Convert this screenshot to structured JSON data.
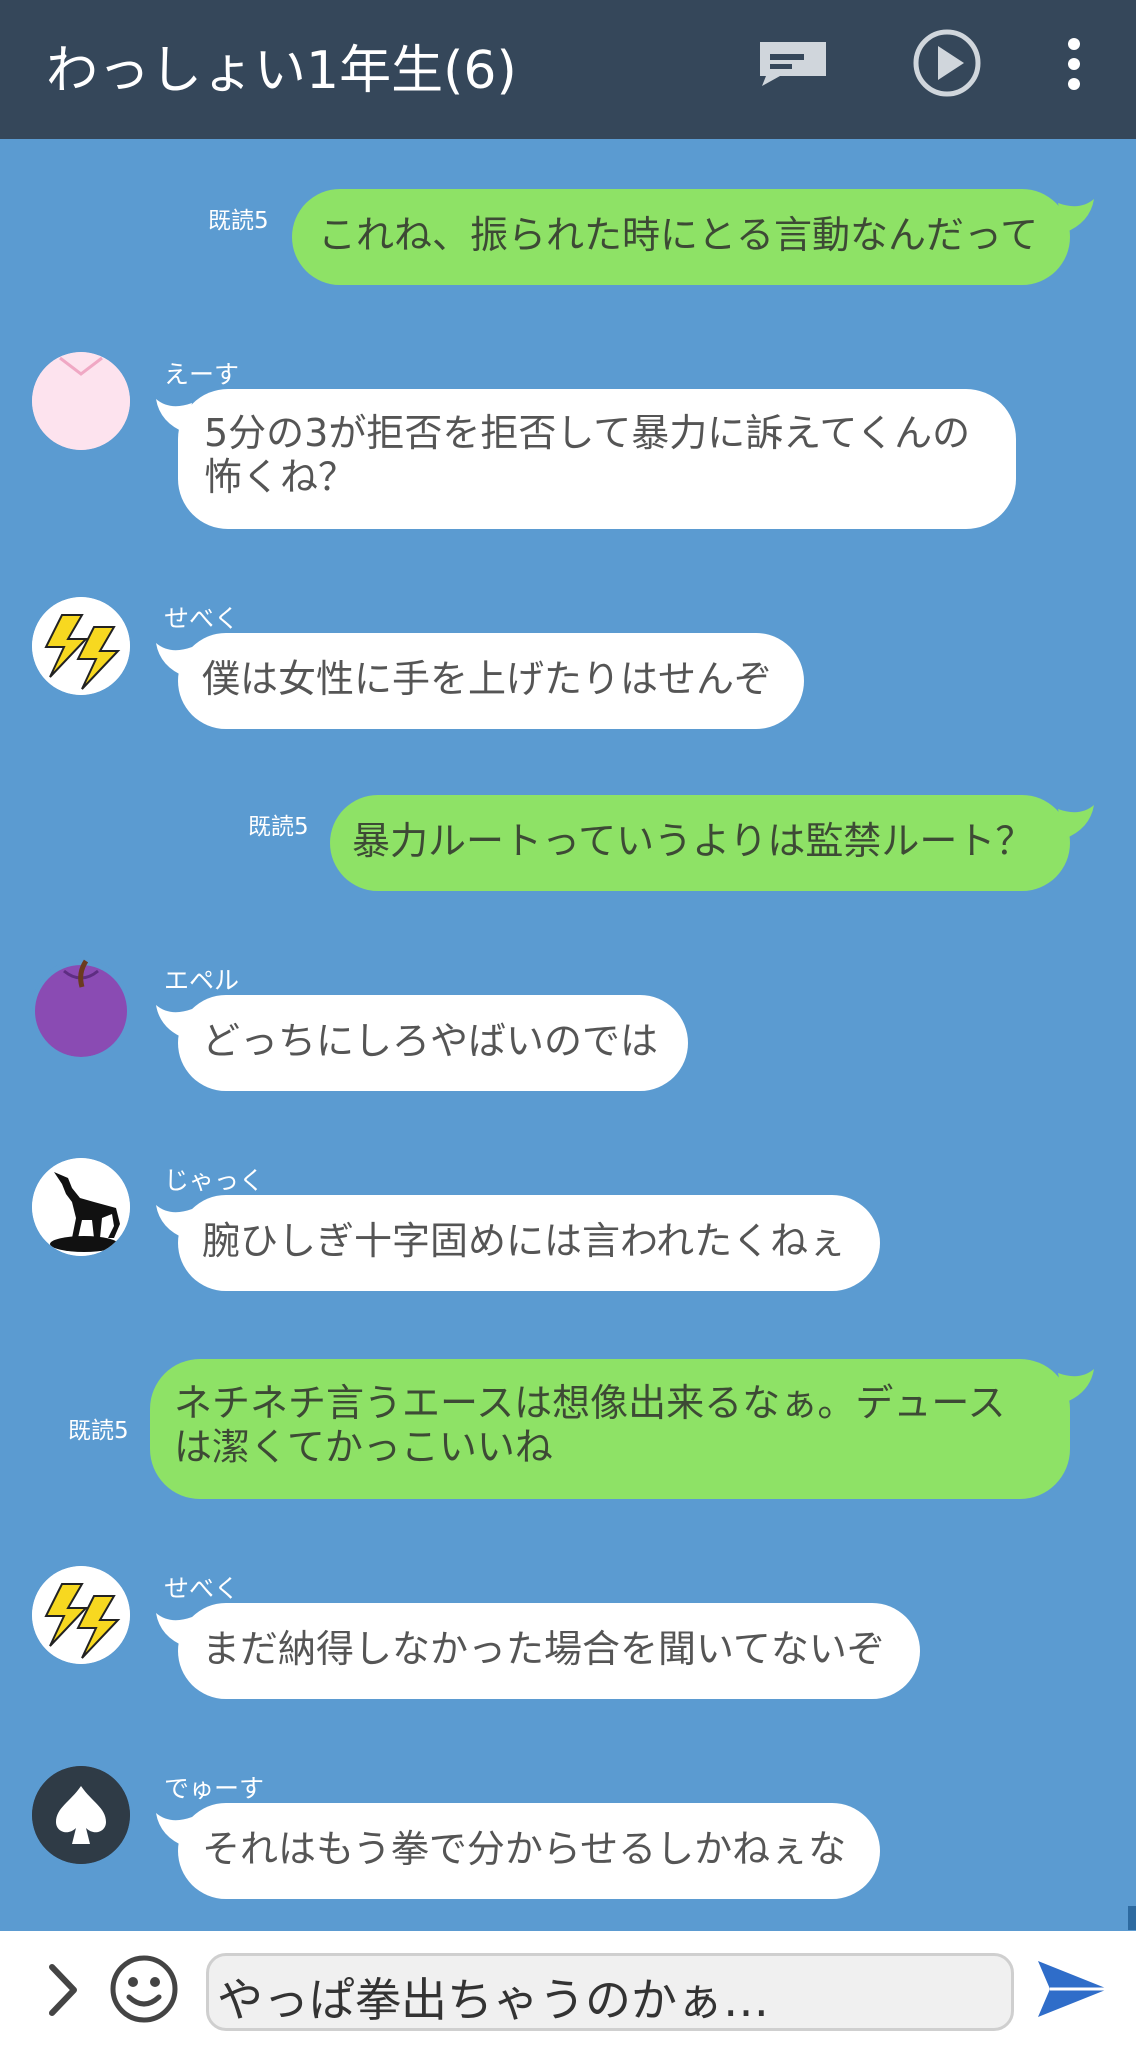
{
  "header": {
    "title": "わっしょい1年生(6)",
    "icons": [
      "notes-icon",
      "play-icon",
      "more-vert-icon"
    ]
  },
  "messages": [
    {
      "type": "outgoing",
      "read": "既読5",
      "lines": [
        "これね、振られた時にとる言動なんだって"
      ]
    },
    {
      "type": "incoming",
      "sender": "えーす",
      "avatar": "pink-heart-avatar",
      "lines": [
        "5分の3が拒否を拒否して暴力に訴えてくんの",
        "怖くね？"
      ]
    },
    {
      "type": "incoming",
      "sender": "せべく",
      "avatar": "lightning-avatar",
      "lines": [
        "僕は女性に手を上げたりはせんぞ"
      ]
    },
    {
      "type": "outgoing",
      "read": "既読5",
      "lines": [
        "暴力ルートっていうよりは監禁ルート？"
      ]
    },
    {
      "type": "incoming",
      "sender": "エペル",
      "avatar": "purple-apple-avatar",
      "lines": [
        "どっちにしろやばいのでは"
      ]
    },
    {
      "type": "incoming",
      "sender": "じゃっく",
      "avatar": "wolf-avatar",
      "lines": [
        "腕ひしぎ十字固めには言われたくねぇ"
      ]
    },
    {
      "type": "outgoing",
      "read": "既読5",
      "lines": [
        "ネチネチ言うエースは想像出来るなぁ。デュース",
        "は潔くてかっこいいね"
      ]
    },
    {
      "type": "incoming",
      "sender": "せべく",
      "avatar": "lightning-avatar",
      "lines": [
        "まだ納得しなかった場合を聞いてないぞ"
      ]
    },
    {
      "type": "incoming",
      "sender": "でゅーす",
      "avatar": "spade-avatar",
      "lines": [
        "それはもう拳で分からせるしかねぇな"
      ]
    }
  ],
  "input": {
    "value": "やっぱ拳出ちゃうのかぁ…",
    "icons": [
      "chevron-right-icon",
      "emoji-icon",
      "send-icon"
    ]
  },
  "colors": {
    "header_bg": "#35475a",
    "chat_bg": "#5b9bd1",
    "outgoing_bubble": "#8ee266",
    "incoming_bubble": "#ffffff",
    "send_icon": "#2f6dc9"
  }
}
